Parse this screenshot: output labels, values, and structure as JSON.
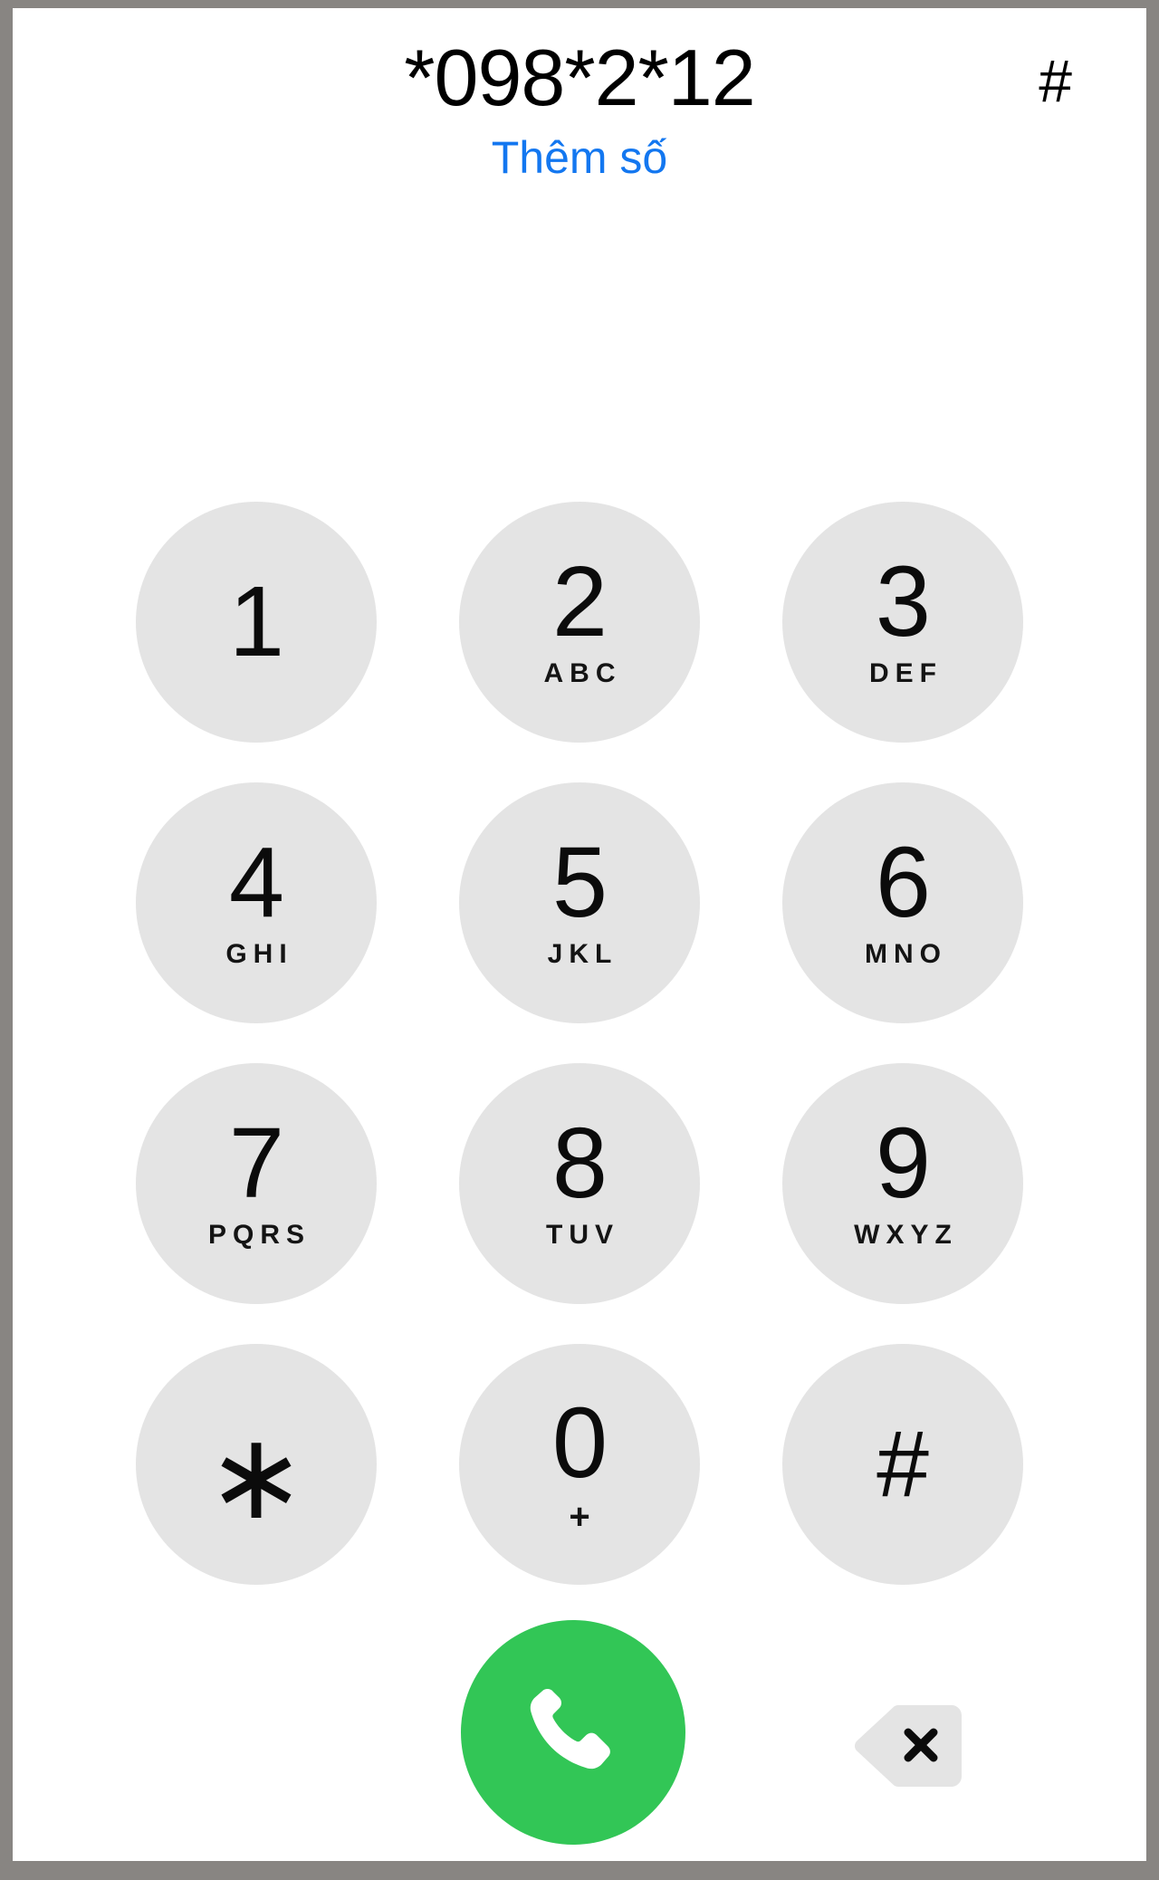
{
  "screen": {
    "name": "phone-dialer",
    "background_color": "#ffffff",
    "frame_color": "#888582"
  },
  "display": {
    "dialed_number": "*098*2*12",
    "hash_indicator": "#",
    "add_number_label": "Thêm số",
    "add_number_color": "#1377f0"
  },
  "keypad": {
    "key_background": "#e4e4e4",
    "rows": [
      [
        {
          "digit": "1",
          "letters": ""
        },
        {
          "digit": "2",
          "letters": "ABC"
        },
        {
          "digit": "3",
          "letters": "DEF"
        }
      ],
      [
        {
          "digit": "4",
          "letters": "GHI"
        },
        {
          "digit": "5",
          "letters": "JKL"
        },
        {
          "digit": "6",
          "letters": "MNO"
        }
      ],
      [
        {
          "digit": "7",
          "letters": "PQRS"
        },
        {
          "digit": "8",
          "letters": "TUV"
        },
        {
          "digit": "9",
          "letters": "WXYZ"
        }
      ],
      [
        {
          "digit": "∗",
          "letters": ""
        },
        {
          "digit": "0",
          "letters": "+"
        },
        {
          "digit": "#",
          "letters": ""
        }
      ]
    ]
  },
  "actions": {
    "call_button": {
      "icon": "phone-handset-icon",
      "color": "#32c656"
    },
    "delete_button": {
      "icon": "backspace-delete-icon",
      "color": "#e4e4e4"
    }
  }
}
